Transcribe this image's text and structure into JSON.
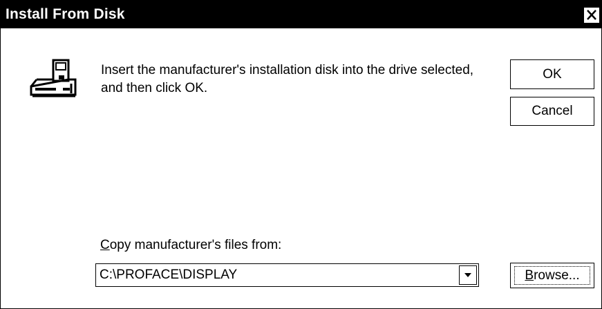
{
  "window": {
    "title": "Install From Disk",
    "close_icon": "close-icon"
  },
  "icons": {
    "disk": "floppy-drive-icon",
    "dropdown": "chevron-down-icon"
  },
  "message": "Insert the manufacturer's installation disk into the drive selected, and then click OK.",
  "buttons": {
    "ok": "OK",
    "cancel": "Cancel",
    "browse_mnemonic": "B",
    "browse_rest": "rowse..."
  },
  "copy_from": {
    "label_mnemonic": "C",
    "label_rest": "opy manufacturer's files from:",
    "value": "C:\\PROFACE\\DISPLAY"
  },
  "colors": {
    "titlebar": "#000000",
    "title_text": "#ffffff",
    "background": "#ffffff"
  }
}
